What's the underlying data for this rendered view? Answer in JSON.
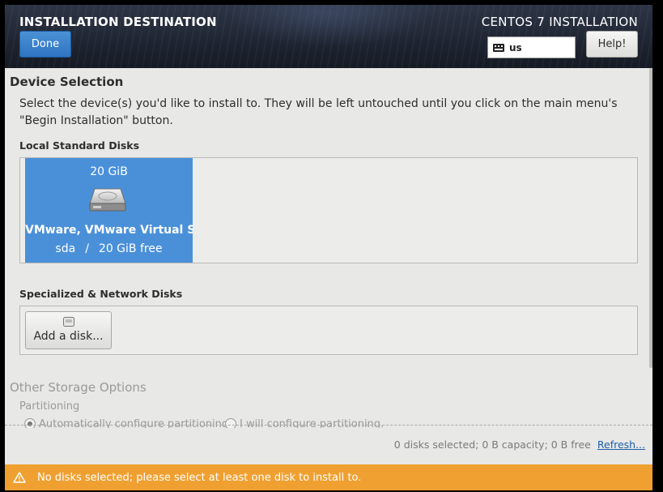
{
  "header": {
    "spoke_title": "INSTALLATION DESTINATION",
    "done_label": "Done",
    "product_title": "CENTOS 7 INSTALLATION",
    "keyboard_layout": "us",
    "help_label": "Help!"
  },
  "device_selection": {
    "title": "Device Selection",
    "intro_line1": "Select the device(s) you'd like to install to.  They will be left untouched until you click on the main menu's",
    "intro_line2": "\"Begin Installation\" button."
  },
  "local_disks": {
    "heading": "Local Standard Disks",
    "disks": [
      {
        "size": "20 GiB",
        "name": "VMware, VMware Virtual S",
        "device": "sda",
        "separator": "/",
        "free": "20 GiB free",
        "icon": "hard-disk-icon",
        "selected_color": "#4a90d9"
      }
    ]
  },
  "network_disks": {
    "heading": "Specialized & Network Disks",
    "add_label": "Add a disk..."
  },
  "other_storage": {
    "title": "Other Storage Options",
    "partitioning_label": "Partitioning",
    "auto_label": "Automatically configure partitioning.",
    "manual_label": "I will configure partitioning."
  },
  "summary": {
    "text": "0 disks selected; 0 B capacity; 0 B free",
    "refresh_label": "Refresh..."
  },
  "warning": {
    "text": "No disks selected; please select at least one disk to install to.",
    "color": "#f0a030",
    "icon": "warning-icon"
  }
}
